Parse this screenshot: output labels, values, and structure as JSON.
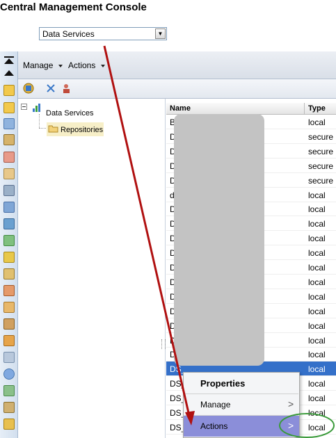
{
  "header": {
    "title": "Central Management Console"
  },
  "selector": {
    "value": "Data Services"
  },
  "toolbar": {
    "manage": "Manage",
    "actions": "Actions"
  },
  "tree": {
    "root": "Data Services",
    "child": "Repositories"
  },
  "list": {
    "columns": [
      "Name",
      "Type"
    ],
    "rows": [
      {
        "name": "B",
        "type": "local"
      },
      {
        "name": "D",
        "type": "secure"
      },
      {
        "name": "D",
        "type": "secure"
      },
      {
        "name": "D",
        "type": "secure"
      },
      {
        "name": "D",
        "type": "secure"
      },
      {
        "name": "d",
        "type": "local"
      },
      {
        "name": "D",
        "type": "local"
      },
      {
        "name": "D",
        "type": "local"
      },
      {
        "name": "D",
        "type": "local"
      },
      {
        "name": "D",
        "type": "local"
      },
      {
        "name": "D",
        "type": "local"
      },
      {
        "name": "D",
        "type": "local"
      },
      {
        "name": "D",
        "type": "local"
      },
      {
        "name": "D",
        "type": "local"
      },
      {
        "name": "D",
        "type": "local"
      },
      {
        "name": "D",
        "type": "local"
      },
      {
        "name": "D",
        "type": "local"
      },
      {
        "name": "DS_",
        "type": "local"
      },
      {
        "name": "DS_",
        "type": "local"
      },
      {
        "name": "DS_",
        "type": "local"
      },
      {
        "name": "DS_",
        "type": "local"
      },
      {
        "name": "DS_",
        "type": "local"
      }
    ]
  },
  "context_menu": {
    "properties": "Properties",
    "manage": "Manage",
    "actions": "Actions",
    "submenu_glyph": ">"
  },
  "colors": {
    "selection": "#3470c9",
    "highlight": "#8b8ed9",
    "annotation_arrow": "#b01010",
    "annotation_circle": "#3a9a3a"
  }
}
